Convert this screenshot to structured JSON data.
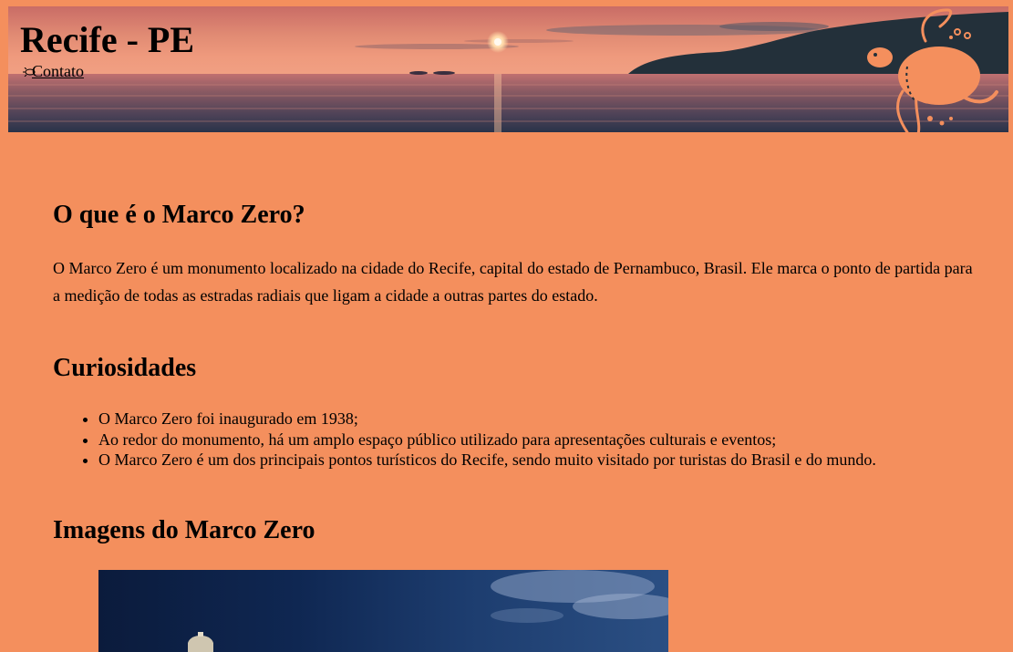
{
  "header": {
    "title": "Recife - PE",
    "nav_link": "Contato",
    "icons": [
      "turtle-icon"
    ]
  },
  "sections": {
    "what": {
      "heading": "O que é o Marco Zero?",
      "paragraph": "O Marco Zero é um monumento localizado na cidade do Recife, capital do estado de Pernambuco, Brasil. Ele marca o ponto de partida para a medição de todas as estradas radiais que ligam a cidade a outras partes do estado."
    },
    "curiosities": {
      "heading": "Curiosidades",
      "items": [
        "O Marco Zero foi inaugurado em 1938;",
        "Ao redor do monumento, há um amplo espaço público utilizado para apresentações culturais e eventos;",
        "O Marco Zero é um dos principais pontos turísticos do Recife, sendo muito visitado por turistas do Brasil e do mundo."
      ]
    },
    "images": {
      "heading": "Imagens do Marco Zero"
    }
  },
  "colors": {
    "page_background": "#f48f5d",
    "turtle": "#f48f5d",
    "text": "#000000"
  }
}
